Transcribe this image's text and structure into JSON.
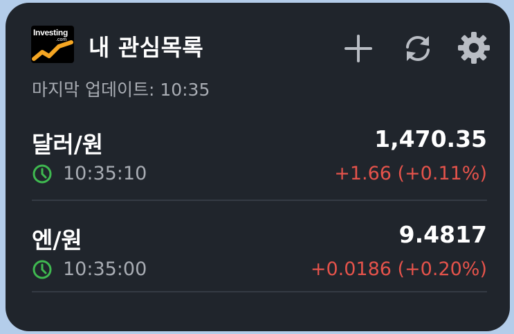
{
  "header": {
    "logo_text": "Investing",
    "logo_suffix": ".com",
    "title": "내 관심목록",
    "actions": [
      {
        "name": "add",
        "icon": "plus-icon"
      },
      {
        "name": "refresh",
        "icon": "refresh-icon"
      },
      {
        "name": "settings",
        "icon": "gear-icon"
      }
    ]
  },
  "last_updated": "마지막 업데이트: 10:35",
  "watchlist": [
    {
      "name": "달러/원",
      "price": "1,470.35",
      "time": "10:35:10",
      "change": "+1.66 (+0.11%)"
    },
    {
      "name": "엔/원",
      "price": "9.4817",
      "time": "10:35:00",
      "change": "+0.0186 (+0.20%)"
    }
  ],
  "colors": {
    "background": "#20252c",
    "text": "#ffffff",
    "muted": "#a9adb4",
    "up": "#e5534b",
    "clock": "#3fb950",
    "logo_accent": "#f5a623"
  }
}
